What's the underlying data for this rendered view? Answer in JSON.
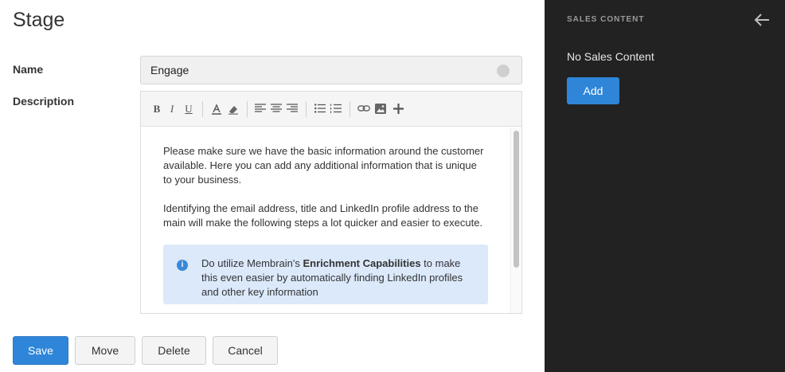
{
  "page": {
    "title": "Stage"
  },
  "form": {
    "name_label": "Name",
    "name_value": "Engage",
    "description_label": "Description"
  },
  "toolbar": {
    "bold": "B",
    "italic": "I",
    "underline": "U",
    "icons": [
      "font-color-icon",
      "eraser-icon",
      "align-left-icon",
      "align-center-icon",
      "align-right-icon",
      "bullet-list-icon",
      "numbered-list-icon",
      "link-icon",
      "image-icon",
      "plus-icon"
    ]
  },
  "description": {
    "paragraph1": "Please make sure we have the basic information around the customer available. Here you can add any additional information that is unique to your business.",
    "paragraph2": "Identifying the email address, title and LinkedIn profile address to the main will make the following steps a lot quicker and easier to execute.",
    "info_prefix": "Do utilize Membrain's ",
    "info_bold": "Enrichment Capabilities",
    "info_suffix": " to make this even easier by automatically finding LinkedIn profiles and other key information"
  },
  "buttons": {
    "save": "Save",
    "move": "Move",
    "delete": "Delete",
    "cancel": "Cancel"
  },
  "side_panel": {
    "title": "SALES CONTENT",
    "empty_text": "No Sales Content",
    "add_label": "Add"
  },
  "colors": {
    "accent": "#2f86d8",
    "panel_bg": "#222222",
    "info_bg": "#dbe9fb"
  }
}
